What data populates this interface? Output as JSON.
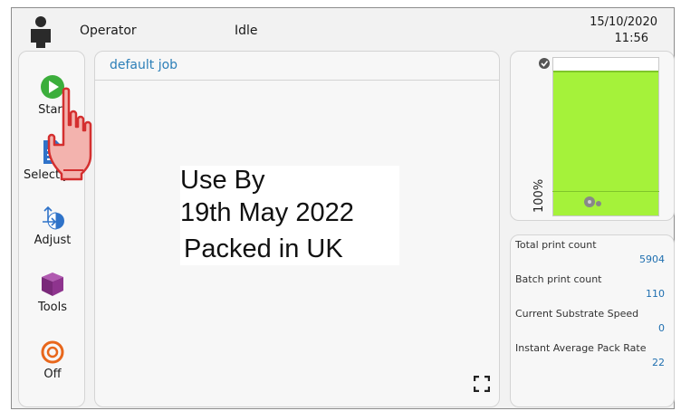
{
  "header": {
    "operator_icon": "person-icon",
    "user": "Operator",
    "status": "Idle",
    "date": "15/10/2020",
    "time": "11:56"
  },
  "sidebar": {
    "items": [
      {
        "label": "Start",
        "icon": "play-icon",
        "color": "#3cae3c"
      },
      {
        "label": "Select job",
        "icon": "document-icon",
        "color": "#2f73c9"
      },
      {
        "label": "Adjust",
        "icon": "adjust-icon",
        "color": "#2f73c9"
      },
      {
        "label": "Tools",
        "icon": "toolbox-icon",
        "color": "#8a2d8a"
      },
      {
        "label": "Off",
        "icon": "power-icon",
        "color": "#e8671c"
      }
    ]
  },
  "main": {
    "job_name": "default job",
    "preview_lines": [
      "Use By",
      "19th May 2022",
      "Packed in UK"
    ],
    "expand_icon": "fullscreen-icon"
  },
  "ink": {
    "level_label": "100%",
    "level_percent": 100,
    "fill_color": "#a5f23a",
    "top_icon": "cartridge-icon",
    "bottom_icon": "ribbon-reel-icon"
  },
  "counters": [
    {
      "label": "Total print count",
      "value": "5904"
    },
    {
      "label": "Batch print count",
      "value": "110"
    },
    {
      "label": "Current Substrate Speed",
      "value": "0"
    },
    {
      "label": "Instant Average Pack Rate",
      "value": "22"
    }
  ],
  "overlay": {
    "icon": "hand-pointer-icon"
  }
}
